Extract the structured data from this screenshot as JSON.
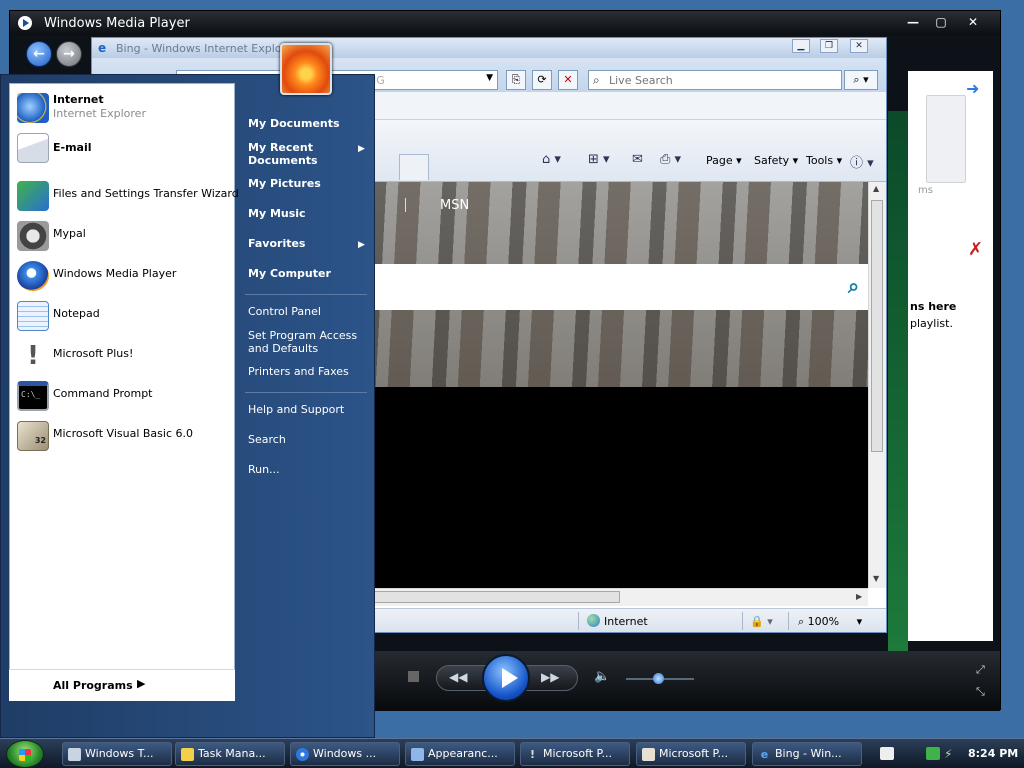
{
  "wmp": {
    "title": "Windows Media Player",
    "right_pane": {
      "items_fragment": "ms",
      "drag_title": "ns here",
      "drag_sub": "playlist."
    }
  },
  "ie": {
    "title": "Bing - Windows Internet Explorer",
    "address_fragment": "IG",
    "search_placeholder": "Live Search",
    "commands": {
      "page": "Page",
      "safety": "Safety",
      "tools": "Tools"
    },
    "content": {
      "msn_link": "MSN"
    },
    "status": {
      "zone": "Internet",
      "zoom": "100%"
    }
  },
  "start_menu": {
    "pinned": [
      {
        "label": "Internet",
        "sublabel": "Internet Explorer"
      },
      {
        "label": "E-mail"
      }
    ],
    "recent": [
      {
        "label": "Files and Settings Transfer Wizard"
      },
      {
        "label": "Mypal"
      },
      {
        "label": "Windows Media Player"
      },
      {
        "label": "Notepad"
      },
      {
        "label": "Microsoft Plus!"
      },
      {
        "label": "Command Prompt"
      },
      {
        "label": "Microsoft Visual Basic 6.0"
      }
    ],
    "all_programs": "All Programs",
    "places": [
      {
        "label": "My Documents"
      },
      {
        "label": "My Recent Documents",
        "line1": "My Recent",
        "line2": "Documents"
      },
      {
        "label": "My Pictures"
      },
      {
        "label": "My Music"
      },
      {
        "label": "Favorites"
      },
      {
        "label": "My Computer"
      },
      {
        "label": "Control Panel"
      },
      {
        "label": "Set Program Access and Defaults",
        "line1": "Set Program Access",
        "line2": "and Defaults"
      },
      {
        "label": "Printers and Faxes"
      },
      {
        "label": "Help and Support"
      },
      {
        "label": "Search"
      },
      {
        "label": "Run..."
      }
    ]
  },
  "taskbar": {
    "tasks": [
      {
        "label": "Windows T..."
      },
      {
        "label": "Task Mana..."
      },
      {
        "label": "Windows ..."
      },
      {
        "label": "Appearanc..."
      },
      {
        "label": "Microsoft P..."
      },
      {
        "label": "Microsoft P..."
      },
      {
        "label": "Bing - Win..."
      }
    ],
    "clock": "8:24 PM"
  },
  "colors": {
    "desktop": "#3a6ea5",
    "start_right": "#2c5489",
    "taskbar": "#1c2c45",
    "play_button": "#1554c9"
  },
  "icons": {
    "start": "windows-orb-icon",
    "ie": "internet-explorer-icon",
    "email": "email-envelope-icon",
    "wmp": "media-player-icon"
  }
}
